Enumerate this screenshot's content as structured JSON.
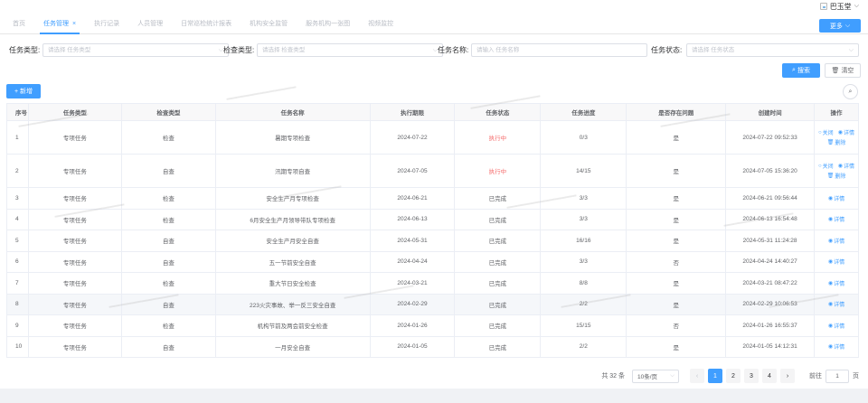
{
  "user": {
    "name": "巴玉堂"
  },
  "tabs": [
    {
      "label": "首页",
      "active": false
    },
    {
      "label": "任务管理",
      "active": true
    },
    {
      "label": "执行记录",
      "active": false
    },
    {
      "label": "人员管理",
      "active": false
    },
    {
      "label": "日常巡检统计报表",
      "active": false
    },
    {
      "label": "机构安全监管",
      "active": false
    },
    {
      "label": "服务机构一张图",
      "active": false
    },
    {
      "label": "视频监控",
      "active": false
    }
  ],
  "more_button": "更多",
  "filters": {
    "task_type": {
      "label": "任务类型:",
      "placeholder": "请选择 任务类型"
    },
    "check_type": {
      "label": "检查类型:",
      "placeholder": "请选择 检查类型"
    },
    "task_name": {
      "label": "任务名称:",
      "placeholder": "请输入 任务名称"
    },
    "task_status": {
      "label": "任务状态:",
      "placeholder": "请选择 任务状态"
    }
  },
  "buttons": {
    "search": "搜索",
    "reset": "清空",
    "add": "新增"
  },
  "columns": [
    "序号",
    "任务类型",
    "检查类型",
    "任务名称",
    "执行期限",
    "任务状态",
    "任务进度",
    "是否存在问题",
    "创建时间",
    "操作"
  ],
  "rows": [
    {
      "no": "1",
      "task_type": "专项任务",
      "check_type": "检查",
      "name": "暑期专项检查",
      "deadline": "2024-07-22",
      "status": "执行中",
      "progress": "0/3",
      "problem": "是",
      "created": "2024-07-22 09:52:33",
      "ops": [
        "关闭",
        "详情",
        "删除"
      ]
    },
    {
      "no": "2",
      "task_type": "专项任务",
      "check_type": "自查",
      "name": "汛期专项自查",
      "deadline": "2024-07-05",
      "status": "执行中",
      "progress": "14/15",
      "problem": "是",
      "created": "2024-07-05 15:36:20",
      "ops": [
        "关闭",
        "详情",
        "删除"
      ]
    },
    {
      "no": "3",
      "task_type": "专项任务",
      "check_type": "检查",
      "name": "安全生产月专项检查",
      "deadline": "2024-06-21",
      "status": "已完成",
      "progress": "3/3",
      "problem": "是",
      "created": "2024-06-21 09:56:44",
      "ops": [
        "详情"
      ]
    },
    {
      "no": "4",
      "task_type": "专项任务",
      "check_type": "检查",
      "name": "6月安全生产月领导带队专项检查",
      "deadline": "2024-06-13",
      "status": "已完成",
      "progress": "3/3",
      "problem": "是",
      "created": "2024-06-13 16:54:48",
      "ops": [
        "详情"
      ]
    },
    {
      "no": "5",
      "task_type": "专项任务",
      "check_type": "自查",
      "name": "安全生产月安全自查",
      "deadline": "2024-05-31",
      "status": "已完成",
      "progress": "16/16",
      "problem": "是",
      "created": "2024-05-31 11:24:28",
      "ops": [
        "详情"
      ]
    },
    {
      "no": "6",
      "task_type": "专项任务",
      "check_type": "自查",
      "name": "五一节前安全自查",
      "deadline": "2024-04-24",
      "status": "已完成",
      "progress": "3/3",
      "problem": "否",
      "created": "2024-04-24 14:40:27",
      "ops": [
        "详情"
      ]
    },
    {
      "no": "7",
      "task_type": "专项任务",
      "check_type": "检查",
      "name": "重大节日安全检查",
      "deadline": "2024-03-21",
      "status": "已完成",
      "progress": "8/8",
      "problem": "是",
      "created": "2024-03-21 08:47:22",
      "ops": [
        "详情"
      ]
    },
    {
      "no": "8",
      "task_type": "专项任务",
      "check_type": "自查",
      "name": "223火灾事故、举一反三安全自查",
      "deadline": "2024-02-29",
      "status": "已完成",
      "progress": "2/2",
      "problem": "是",
      "created": "2024-02-29 10:06:53",
      "ops": [
        "详情"
      ]
    },
    {
      "no": "9",
      "task_type": "专项任务",
      "check_type": "检查",
      "name": "机构节前及两会前安全检查",
      "deadline": "2024-01-26",
      "status": "已完成",
      "progress": "15/15",
      "problem": "否",
      "created": "2024-01-26 16:55:37",
      "ops": [
        "详情"
      ]
    },
    {
      "no": "10",
      "task_type": "专项任务",
      "check_type": "自查",
      "name": "一月安全自查",
      "deadline": "2024-01-05",
      "status": "已完成",
      "progress": "2/2",
      "problem": "是",
      "created": "2024-01-05 14:12:31",
      "ops": [
        "详情"
      ]
    }
  ],
  "pagination": {
    "total": "共 32 条",
    "page_size": "10条/页",
    "pages": [
      "1",
      "2",
      "3",
      "4"
    ],
    "current": "1",
    "goto_label": "前往",
    "goto_value": "1",
    "goto_suffix": "页"
  },
  "colors": {
    "primary": "#409eff",
    "danger": "#f56c6c"
  }
}
